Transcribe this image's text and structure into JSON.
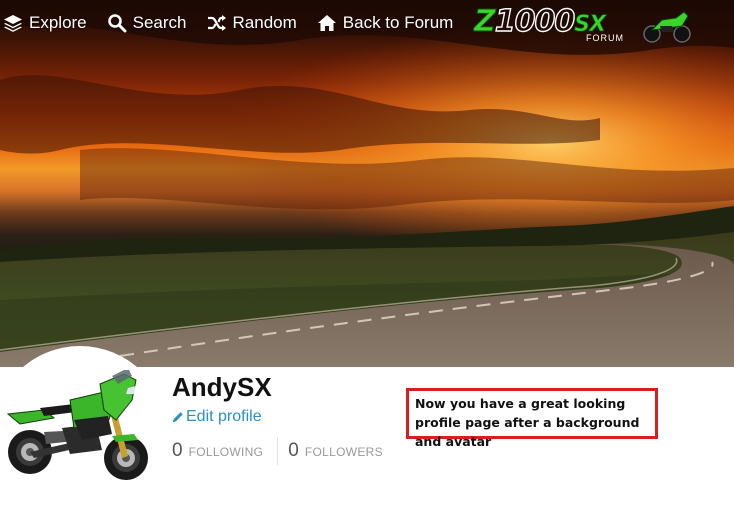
{
  "nav": {
    "items": [
      {
        "label": "Explore",
        "icon": "layers-icon"
      },
      {
        "label": "Search",
        "icon": "search-icon"
      },
      {
        "label": "Random",
        "icon": "shuffle-icon"
      },
      {
        "label": "Back to Forum",
        "icon": "home-icon"
      }
    ]
  },
  "logo": {
    "prefix": "Z",
    "text": "1000",
    "suffix": "SX",
    "subtitle": "FORUM"
  },
  "profile": {
    "username": "AndySX",
    "edit_label": "Edit profile",
    "following_count": "0",
    "following_label": "FOLLOWING",
    "followers_count": "0",
    "followers_label": "FOLLOWERS"
  },
  "annotation": {
    "text": "Now you have a great looking profile page after a background and avatar"
  },
  "colors": {
    "link": "#2a8fc7",
    "callout_border": "#d42020",
    "bike_green": "#3bb52a"
  }
}
